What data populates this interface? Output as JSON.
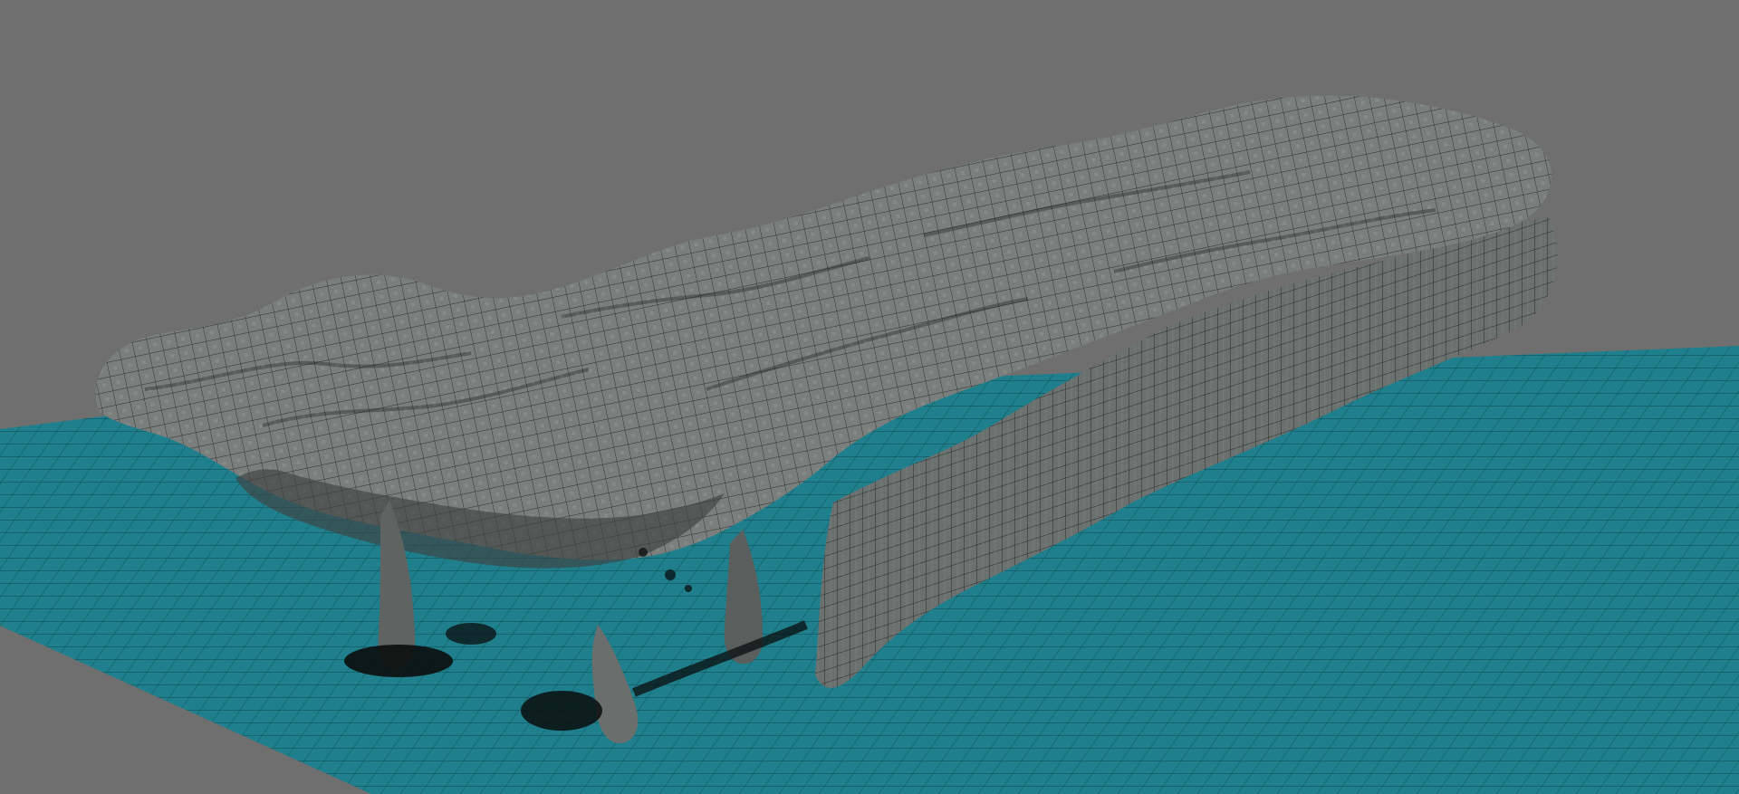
{
  "viewport": {
    "background_color": "#6f6f6f",
    "ground_color": "#1f7f8c",
    "rock_color": "#7b7f7d",
    "wireframe_color": "#1c1c1c",
    "shading": "wireframe-on-shaded"
  },
  "objects": [
    {
      "name": "rock-cliff-mesh"
    },
    {
      "name": "ground-plane-grid"
    },
    {
      "name": "rock-pillars"
    },
    {
      "name": "debris-scatter"
    }
  ]
}
